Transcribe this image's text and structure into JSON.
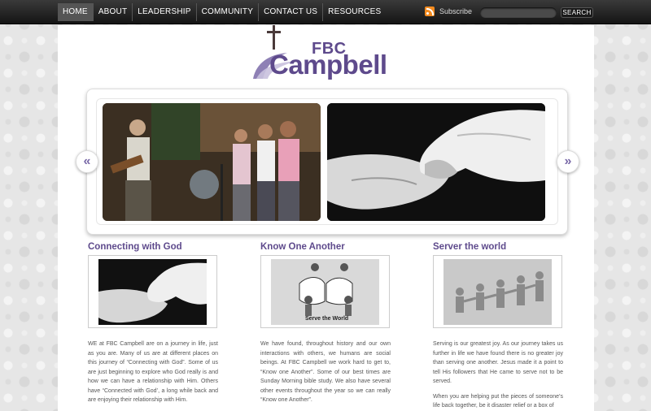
{
  "nav": {
    "items": [
      "HOME",
      "ABOUT",
      "LEADERSHIP",
      "COMMUNITY",
      "CONTACT US",
      "RESOURCES"
    ],
    "subscribe_label": "Subscribe",
    "search_button": "SEARCH"
  },
  "logo": {
    "line1": "FBC",
    "line2": "Campbell",
    "accent_color": "#5e4a8c"
  },
  "slider": {
    "prev_label": "«",
    "next_label": "»"
  },
  "columns": [
    {
      "title": "Connecting with God",
      "paragraphs": [
        "WE at FBC Campbell are on a journey in life, just as you are. Many of us are at different places on this journey of “Connecting with God”. Some of us are just beginning to explore who God really is and how we can have a relationship with Him. Others have “Connected with God’, a long while back and are enjoying their relationship with Him."
      ]
    },
    {
      "title": "Know One Another",
      "thumb_caption": "Serve the World",
      "paragraphs": [
        "We have found, throughout history and our own interactions with others, we humans are social beings. At FBC Campbell we work hard to get to, “Know one Another”. Some of our best times are Sunday Morning bible study. We also have several other events throughout the year so we can really “Know one Another”."
      ]
    },
    {
      "title": "Server the world",
      "paragraphs": [
        "Serving is our greatest joy. As our journey takes us further in life we have found there is no greater joy than serving one another. Jesus made it a point to tell His followers that He came to serve not to be served.",
        "When you are helping put the pieces of someone’s life back together, be it disaster relief or a box of"
      ]
    }
  ]
}
